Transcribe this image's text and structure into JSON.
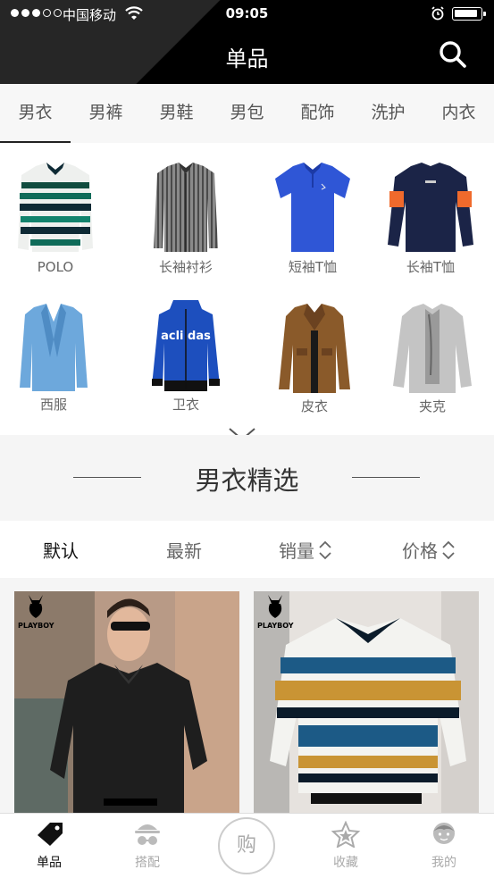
{
  "status_bar": {
    "carrier": "中国移动",
    "time": "09:05"
  },
  "header": {
    "title": "单品"
  },
  "tabs": [
    "男衣",
    "男裤",
    "男鞋",
    "男包",
    "配饰",
    "洗护",
    "内衣"
  ],
  "subcategories": [
    {
      "label": "POLO"
    },
    {
      "label": "长袖衬衫"
    },
    {
      "label": "短袖T恤"
    },
    {
      "label": "长袖T恤"
    },
    {
      "label": "西服"
    },
    {
      "label": "卫衣"
    },
    {
      "label": "皮衣"
    },
    {
      "label": "夹克"
    }
  ],
  "section": {
    "title": "男衣精选"
  },
  "sort": {
    "default": "默认",
    "newest": "最新",
    "sales": "销量",
    "price": "价格"
  },
  "products": [
    {
      "brand": "PLAYBOY"
    },
    {
      "brand": "PLAYBOY"
    }
  ],
  "tabbar": {
    "items": [
      "单品",
      "搭配",
      "收藏",
      "我的"
    ],
    "buy": "购"
  },
  "hoodie_print": "acli das",
  "colors": {
    "header_bg": "#000000",
    "accent": "#111111",
    "inactive": "#aaaaaa"
  }
}
